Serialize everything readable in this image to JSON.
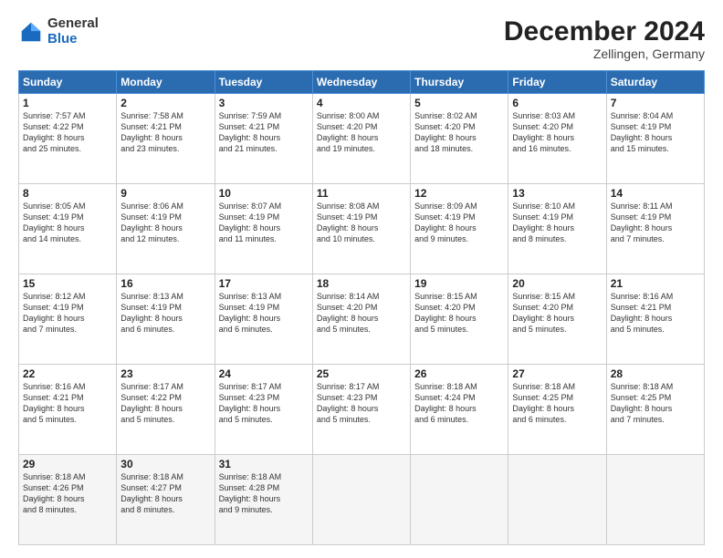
{
  "logo": {
    "general": "General",
    "blue": "Blue"
  },
  "title": "December 2024",
  "subtitle": "Zellingen, Germany",
  "header_days": [
    "Sunday",
    "Monday",
    "Tuesday",
    "Wednesday",
    "Thursday",
    "Friday",
    "Saturday"
  ],
  "weeks": [
    [
      {
        "day": "1",
        "info": "Sunrise: 7:57 AM\nSunset: 4:22 PM\nDaylight: 8 hours\nand 25 minutes."
      },
      {
        "day": "2",
        "info": "Sunrise: 7:58 AM\nSunset: 4:21 PM\nDaylight: 8 hours\nand 23 minutes."
      },
      {
        "day": "3",
        "info": "Sunrise: 7:59 AM\nSunset: 4:21 PM\nDaylight: 8 hours\nand 21 minutes."
      },
      {
        "day": "4",
        "info": "Sunrise: 8:00 AM\nSunset: 4:20 PM\nDaylight: 8 hours\nand 19 minutes."
      },
      {
        "day": "5",
        "info": "Sunrise: 8:02 AM\nSunset: 4:20 PM\nDaylight: 8 hours\nand 18 minutes."
      },
      {
        "day": "6",
        "info": "Sunrise: 8:03 AM\nSunset: 4:20 PM\nDaylight: 8 hours\nand 16 minutes."
      },
      {
        "day": "7",
        "info": "Sunrise: 8:04 AM\nSunset: 4:19 PM\nDaylight: 8 hours\nand 15 minutes."
      }
    ],
    [
      {
        "day": "8",
        "info": "Sunrise: 8:05 AM\nSunset: 4:19 PM\nDaylight: 8 hours\nand 14 minutes."
      },
      {
        "day": "9",
        "info": "Sunrise: 8:06 AM\nSunset: 4:19 PM\nDaylight: 8 hours\nand 12 minutes."
      },
      {
        "day": "10",
        "info": "Sunrise: 8:07 AM\nSunset: 4:19 PM\nDaylight: 8 hours\nand 11 minutes."
      },
      {
        "day": "11",
        "info": "Sunrise: 8:08 AM\nSunset: 4:19 PM\nDaylight: 8 hours\nand 10 minutes."
      },
      {
        "day": "12",
        "info": "Sunrise: 8:09 AM\nSunset: 4:19 PM\nDaylight: 8 hours\nand 9 minutes."
      },
      {
        "day": "13",
        "info": "Sunrise: 8:10 AM\nSunset: 4:19 PM\nDaylight: 8 hours\nand 8 minutes."
      },
      {
        "day": "14",
        "info": "Sunrise: 8:11 AM\nSunset: 4:19 PM\nDaylight: 8 hours\nand 7 minutes."
      }
    ],
    [
      {
        "day": "15",
        "info": "Sunrise: 8:12 AM\nSunset: 4:19 PM\nDaylight: 8 hours\nand 7 minutes."
      },
      {
        "day": "16",
        "info": "Sunrise: 8:13 AM\nSunset: 4:19 PM\nDaylight: 8 hours\nand 6 minutes."
      },
      {
        "day": "17",
        "info": "Sunrise: 8:13 AM\nSunset: 4:19 PM\nDaylight: 8 hours\nand 6 minutes."
      },
      {
        "day": "18",
        "info": "Sunrise: 8:14 AM\nSunset: 4:20 PM\nDaylight: 8 hours\nand 5 minutes."
      },
      {
        "day": "19",
        "info": "Sunrise: 8:15 AM\nSunset: 4:20 PM\nDaylight: 8 hours\nand 5 minutes."
      },
      {
        "day": "20",
        "info": "Sunrise: 8:15 AM\nSunset: 4:20 PM\nDaylight: 8 hours\nand 5 minutes."
      },
      {
        "day": "21",
        "info": "Sunrise: 8:16 AM\nSunset: 4:21 PM\nDaylight: 8 hours\nand 5 minutes."
      }
    ],
    [
      {
        "day": "22",
        "info": "Sunrise: 8:16 AM\nSunset: 4:21 PM\nDaylight: 8 hours\nand 5 minutes."
      },
      {
        "day": "23",
        "info": "Sunrise: 8:17 AM\nSunset: 4:22 PM\nDaylight: 8 hours\nand 5 minutes."
      },
      {
        "day": "24",
        "info": "Sunrise: 8:17 AM\nSunset: 4:23 PM\nDaylight: 8 hours\nand 5 minutes."
      },
      {
        "day": "25",
        "info": "Sunrise: 8:17 AM\nSunset: 4:23 PM\nDaylight: 8 hours\nand 5 minutes."
      },
      {
        "day": "26",
        "info": "Sunrise: 8:18 AM\nSunset: 4:24 PM\nDaylight: 8 hours\nand 6 minutes."
      },
      {
        "day": "27",
        "info": "Sunrise: 8:18 AM\nSunset: 4:25 PM\nDaylight: 8 hours\nand 6 minutes."
      },
      {
        "day": "28",
        "info": "Sunrise: 8:18 AM\nSunset: 4:25 PM\nDaylight: 8 hours\nand 7 minutes."
      }
    ],
    [
      {
        "day": "29",
        "info": "Sunrise: 8:18 AM\nSunset: 4:26 PM\nDaylight: 8 hours\nand 8 minutes."
      },
      {
        "day": "30",
        "info": "Sunrise: 8:18 AM\nSunset: 4:27 PM\nDaylight: 8 hours\nand 8 minutes."
      },
      {
        "day": "31",
        "info": "Sunrise: 8:18 AM\nSunset: 4:28 PM\nDaylight: 8 hours\nand 9 minutes."
      },
      {
        "day": "",
        "info": ""
      },
      {
        "day": "",
        "info": ""
      },
      {
        "day": "",
        "info": ""
      },
      {
        "day": "",
        "info": ""
      }
    ]
  ]
}
